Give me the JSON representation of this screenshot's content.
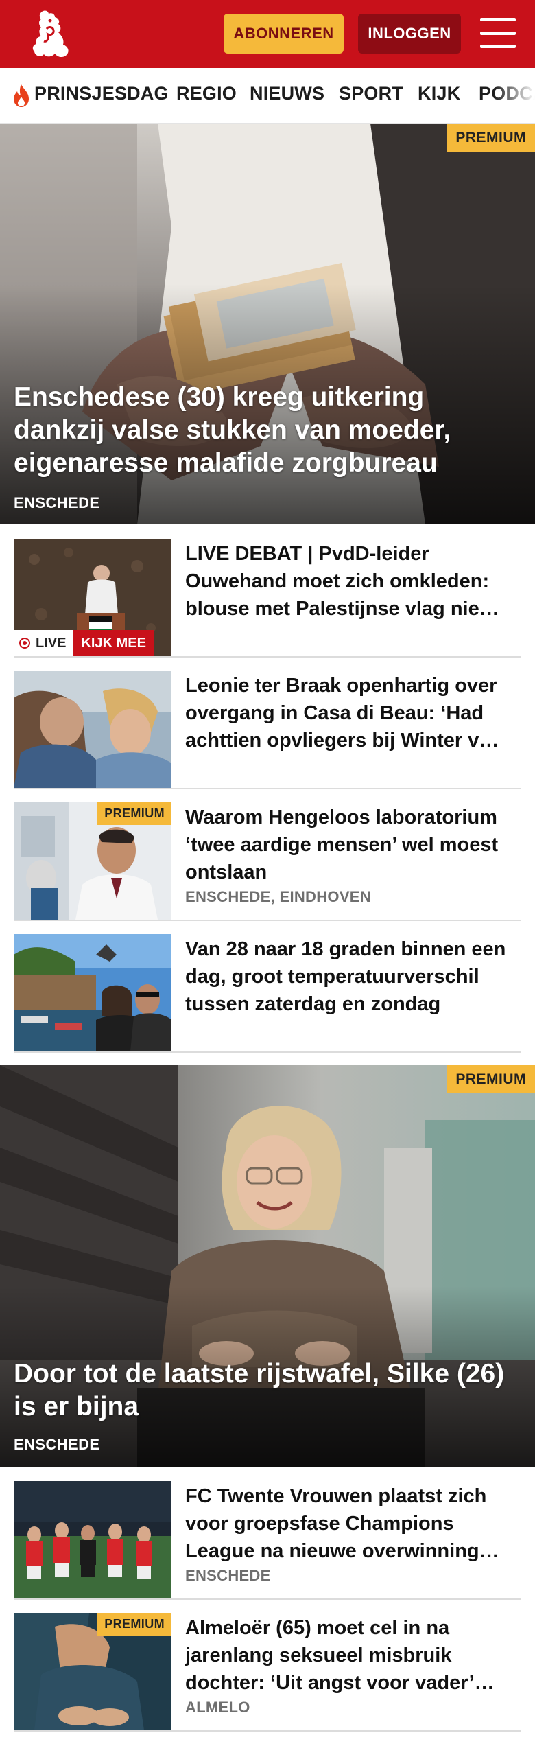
{
  "header": {
    "subscribe_label": "ABONNEREN",
    "login_label": "INLOGGEN",
    "colors": {
      "brand": "#c8111a",
      "subscribe": "#f5b93a",
      "login": "#8e0c14"
    }
  },
  "nav": {
    "items": [
      {
        "label": "PRINSJESDAG",
        "icon": "flame-icon"
      },
      {
        "label": "REGIO"
      },
      {
        "label": "NIEUWS"
      },
      {
        "label": "SPORT"
      },
      {
        "label": "KIJK"
      },
      {
        "label": "PODCA"
      }
    ]
  },
  "hero1": {
    "badge": "PREMIUM",
    "title": "Enschedese (30) kreeg uitkering dankzij valse stukken van moeder, eigenaresse malafide zorgbureau",
    "kicker": "ENSCHEDE"
  },
  "list1": [
    {
      "title": "LIVE DEBAT | PvdD-leider Ouwehand moet zich omkleden: blouse met Palestijnse vlag nie…",
      "live_label": "LIVE",
      "cta": "KIJK MEE"
    },
    {
      "title": "Leonie ter Braak openhartig over overgang in Casa di Beau: ‘Had achttien opvliegers bij Winter v…"
    },
    {
      "title": "Waarom Hengeloos laboratorium ‘twee aardige mensen’ wel moest ontslaan",
      "kicker": "ENSCHEDE, EINDHOVEN",
      "badge": "PREMIUM"
    },
    {
      "title": "Van 28 naar 18 graden binnen een dag, groot temperatuurverschil tussen zaterdag en zondag"
    }
  ],
  "hero2": {
    "badge": "PREMIUM",
    "title": "Door tot de laatste rijstwafel, Silke (26) is er bijna",
    "kicker": "ENSCHEDE"
  },
  "list2": [
    {
      "title": "FC Twente Vrouwen plaatst zich voor groepsfase Champions League na nieuwe overwinning…",
      "kicker": "ENSCHEDE"
    },
    {
      "title": "Almeloër (65) moet cel in na jarenlang seksueel misbruik dochter: ‘Uit angst voor vader’…",
      "kicker": "ALMELO",
      "badge": "PREMIUM"
    }
  ]
}
